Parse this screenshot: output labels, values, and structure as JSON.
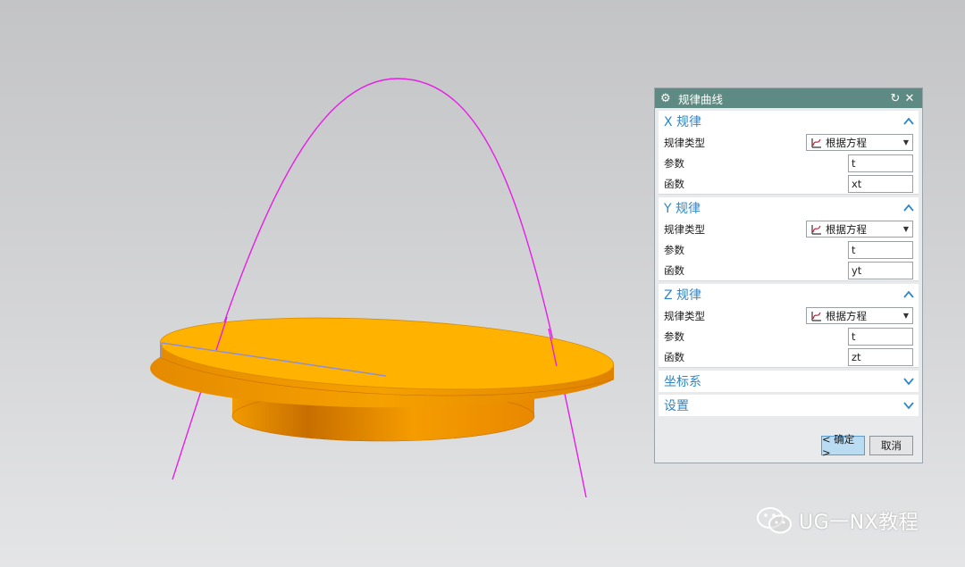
{
  "dialog": {
    "title": "规律曲线",
    "x_law": {
      "header": "X 规律",
      "law_type_label": "规律类型",
      "law_type_value": "根据方程",
      "param_label": "参数",
      "param_value": "t",
      "func_label": "函数",
      "func_value": "xt"
    },
    "y_law": {
      "header": "Y 规律",
      "law_type_label": "规律类型",
      "law_type_value": "根据方程",
      "param_label": "参数",
      "param_value": "t",
      "func_label": "函数",
      "func_value": "yt"
    },
    "z_law": {
      "header": "Z 规律",
      "law_type_label": "规律类型",
      "law_type_value": "根据方程",
      "param_label": "参数",
      "param_value": "t",
      "func_label": "函数",
      "func_value": "zt"
    },
    "coord_system": "坐标系",
    "settings": "设置",
    "ok_label": "< 确定 >",
    "cancel_label": "取消"
  },
  "watermark": "UG一NX教程",
  "colors": {
    "title_bar": "#5d8a82",
    "section_header": "#2f86c8",
    "curve": "#e61ee6",
    "disc_top": "#ffb300",
    "disc_side": "#e88a00"
  }
}
